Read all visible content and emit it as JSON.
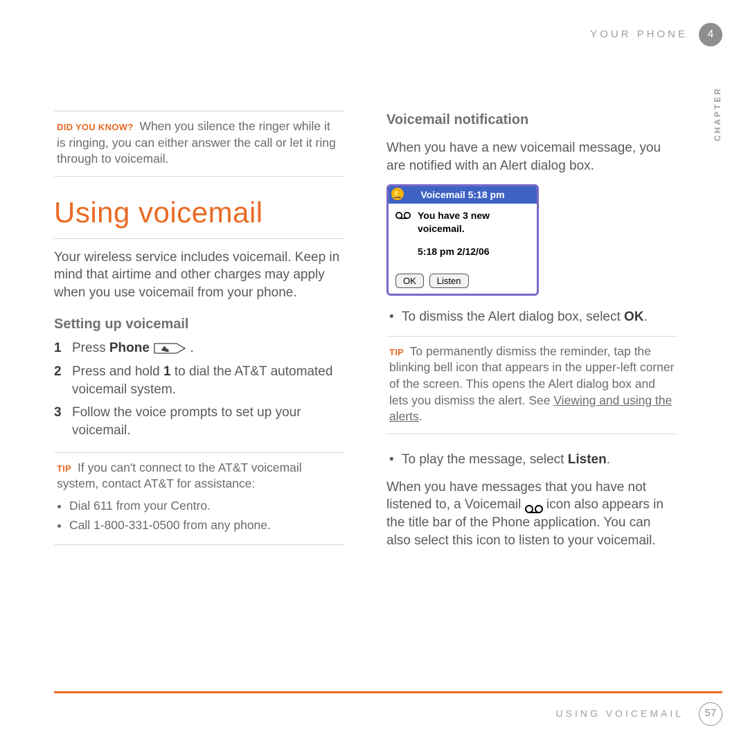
{
  "header": {
    "section": "YOUR PHONE",
    "chapter_no": "4",
    "side_label": "CHAPTER"
  },
  "left": {
    "box1_lead": "DID YOU KNOW?",
    "box1_text": "When you silence the ringer while it is ringing, you can either answer the call or let it ring through to voicemail.",
    "h1": "Using voicemail",
    "intro": "Your wireless service includes voicemail. Keep in mind that airtime and other charges may apply when you use voicemail from your phone.",
    "sub1": "Setting up voicemail",
    "step1_num": "1",
    "step1_a": "Press ",
    "step1_b": "Phone",
    "step1_c": " .",
    "step2_num": "2",
    "step2_a": "Press and hold ",
    "step2_b": "1",
    "step2_c": " to dial the AT&T automated voicemail system.",
    "step3_num": "3",
    "step3_a": "Follow the voice prompts to set up your voicemail.",
    "box2_lead": "TIP",
    "box2_text": "If you can't connect to the AT&T voicemail system, contact AT&T for assistance:",
    "box2_b1": "Dial 611 from your Centro.",
    "box2_b2": "Call 1-800-331-0500 from any phone."
  },
  "right": {
    "sub1": "Voicemail notification",
    "intro": "When you have a new voicemail message, you are notified with an Alert dialog box.",
    "shot": {
      "title": "Voicemail   5:18 pm",
      "line1": "You have 3 new voicemail.",
      "line2": "5:18 pm 2/12/06",
      "btn_ok": "OK",
      "btn_listen": "Listen"
    },
    "bul1_a": "To dismiss the Alert dialog box, select ",
    "bul1_b": "OK",
    "bul1_c": ".",
    "box_lead": "TIP",
    "box_a": "To permanently dismiss the reminder, tap the blinking bell icon that appears in the upper-left corner of the screen. This opens the Alert dialog box and lets you dismiss the alert. See ",
    "box_link": "Viewing and using the alerts",
    "box_b": ".",
    "bul2_a": "To play the message, select ",
    "bul2_b": "Listen",
    "bul2_c": ".",
    "para_a": "When you have messages that you have not listened to, a Voicemail ",
    "para_b": " icon also appears in the title bar of the Phone application. You can also select this icon to listen to your voicemail."
  },
  "footer": {
    "label": "USING VOICEMAIL",
    "page": "57"
  }
}
